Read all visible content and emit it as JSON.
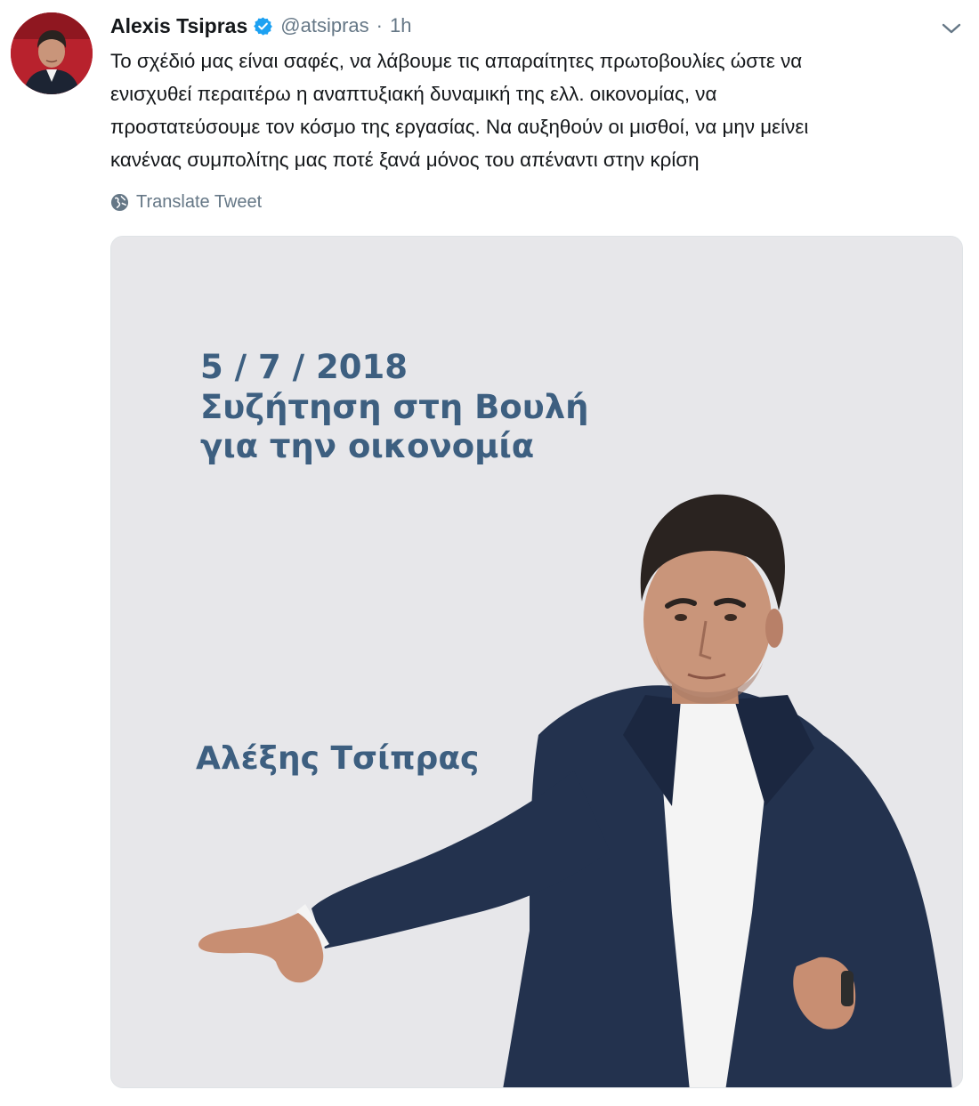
{
  "tweet": {
    "author_name": "Alexis Tsipras",
    "handle": "@atsipras",
    "separator": "·",
    "time": "1h",
    "text_lines": [
      "Το σχέδιό μας είναι σαφές, να λάβουμε τις απαραίτητες πρωτοβουλίες ώστε να",
      "ενισχυθεί περαιτέρω η αναπτυξιακή δυναμική της ελλ. οικονομίας, να",
      "προστατεύσουμε τον κόσμο της εργασίας. Να αυξηθούν οι μισθοί, να μην μείνει",
      "κανένας συμπολίτης μας ποτέ ξανά μόνος του απέναντι στην κρίση"
    ],
    "translate_label": "Translate Tweet",
    "icons": {
      "verified": "verified-badge-icon",
      "chevron": "chevron-down-icon",
      "globe": "globe-icon"
    },
    "colors": {
      "verified": "#1da1f2",
      "secondary_text": "#657786",
      "poster_text": "#3d5f80",
      "poster_bg": "#e7e7ea"
    }
  },
  "poster": {
    "date": "5 / 7 / 2018",
    "line1": "Συζήτηση στη Βουλή",
    "line2": "για την οικονομία",
    "name": "Αλέξης Τσίπρας"
  }
}
